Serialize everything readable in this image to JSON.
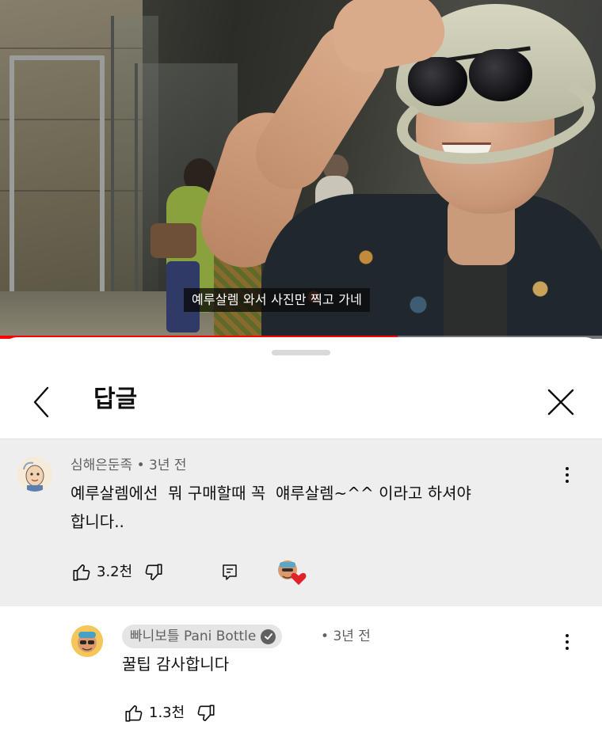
{
  "video": {
    "subtitle": "예루살렘 와서 사진만 찍고 가네",
    "progress": 0.66
  },
  "sheet": {
    "title": "답글",
    "back_icon": "chevron-left-icon",
    "close_icon": "close-icon"
  },
  "parent_comment": {
    "author": "심해은둔족",
    "age": "3년 전",
    "text_line1": "예루살렘에선  뭐 구매할때 꼭  얘루살렘~^^ 이라고 하셔야",
    "text_line2": "합니다..",
    "likes": "3.2천",
    "icons": [
      "thumb-up-icon",
      "thumb-down-icon",
      "reply-icon",
      "creator-heart-icon",
      "more-vert-icon"
    ]
  },
  "reply_comment": {
    "author": "빠니보틀 Pani Bottle",
    "verified": true,
    "age": "3년 전",
    "text": "꿀팁 감사합니다",
    "likes": "1.3천",
    "icons": [
      "thumb-up-icon",
      "thumb-down-icon",
      "more-vert-icon"
    ]
  },
  "colors": {
    "progress": "#ff0000",
    "heart": "#e0222b",
    "parent_bg": "#eeeeee"
  }
}
